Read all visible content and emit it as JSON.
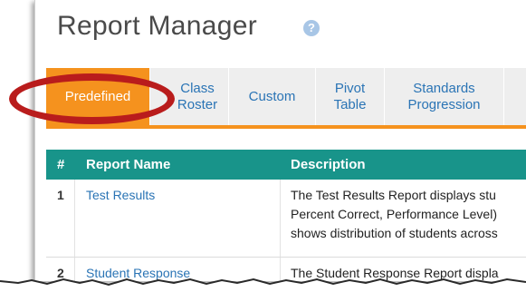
{
  "header": {
    "title": "Report Manager",
    "help_icon": "?"
  },
  "tabs": [
    {
      "label": "Predefined",
      "active": true
    },
    {
      "label": "Class Roster",
      "active": false
    },
    {
      "label": "Custom",
      "active": false
    },
    {
      "label": "Pivot Table",
      "active": false
    },
    {
      "label": "Standards Progression",
      "active": false
    }
  ],
  "table": {
    "columns": [
      "#",
      "Report Name",
      "Description"
    ],
    "rows": [
      {
        "num": "1",
        "name": "Test Results",
        "desc": [
          "The Test Results Report displays stu",
          "Percent Correct, Performance Level)",
          "shows distribution of students across"
        ]
      },
      {
        "num": "2",
        "name": "Student Response",
        "desc": [
          "The Student Response Report displa"
        ]
      }
    ]
  },
  "colors": {
    "accent": "#f5921e",
    "header": "#18948a",
    "link": "#2a74b5",
    "highlight": "#b91c1c"
  }
}
